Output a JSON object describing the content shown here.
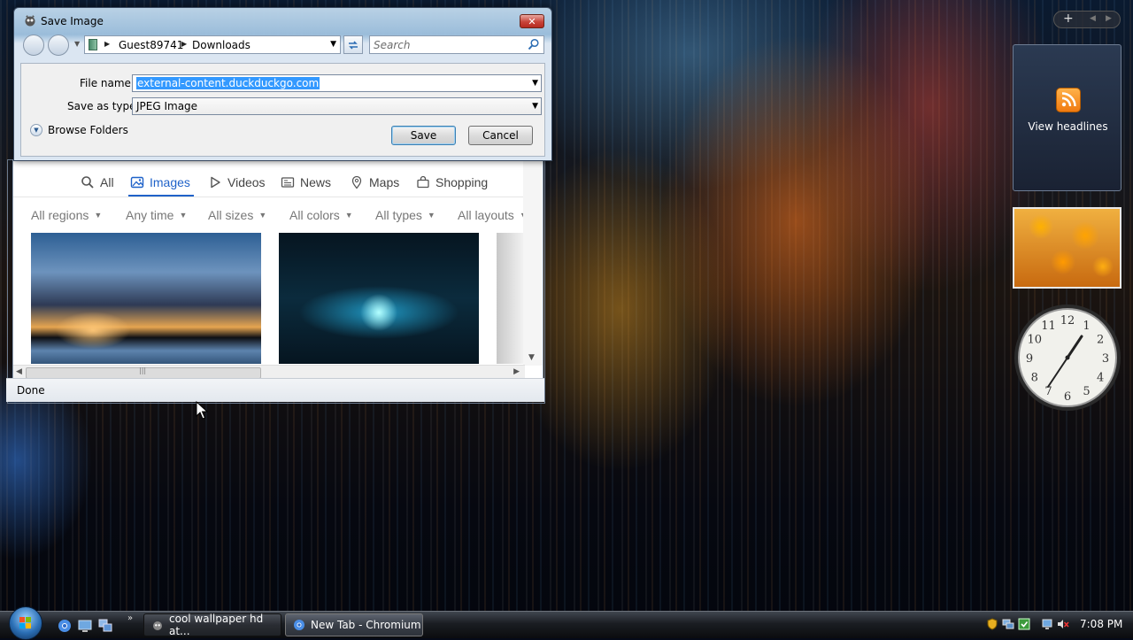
{
  "colors": {
    "accent_blue": "#1f62c9",
    "selection": "#3399ff",
    "close_red": "#c8443a"
  },
  "dialog": {
    "title": "Save Image",
    "close_glyph": "✕",
    "address": {
      "segments": [
        "Guest89741",
        "Downloads"
      ]
    },
    "search_placeholder": "Search",
    "file_name_label": "File name:",
    "file_name_value": "external-content.duckduckgo.com",
    "save_type_label": "Save as type:",
    "save_type_value": "JPEG Image",
    "browse_folders_label": "Browse Folders",
    "save_button": "Save",
    "cancel_button": "Cancel"
  },
  "browser": {
    "nav_tabs": [
      {
        "label": "All",
        "icon": "search-icon"
      },
      {
        "label": "Images",
        "icon": "image-icon",
        "active": true
      },
      {
        "label": "Videos",
        "icon": "play-icon"
      },
      {
        "label": "News",
        "icon": "newspaper-icon"
      },
      {
        "label": "Maps",
        "icon": "map-pin-icon"
      },
      {
        "label": "Shopping",
        "icon": "shopping-bag-icon"
      }
    ],
    "filters": [
      "All regions",
      "Any time",
      "All sizes",
      "All colors",
      "All types",
      "All layouts"
    ],
    "status": "Done"
  },
  "sidebar": {
    "add_glyph": "+",
    "feed_label": "View headlines",
    "clock_numbers": [
      "12",
      "1",
      "2",
      "3",
      "4",
      "5",
      "6",
      "7",
      "8",
      "9",
      "10",
      "11"
    ]
  },
  "taskbar": {
    "more_glyph": "»",
    "tasks": [
      {
        "label": "cool wallpaper hd at...",
        "active": false
      },
      {
        "label": "New Tab - Chromium",
        "active": true
      }
    ],
    "time": "7:08 PM"
  }
}
